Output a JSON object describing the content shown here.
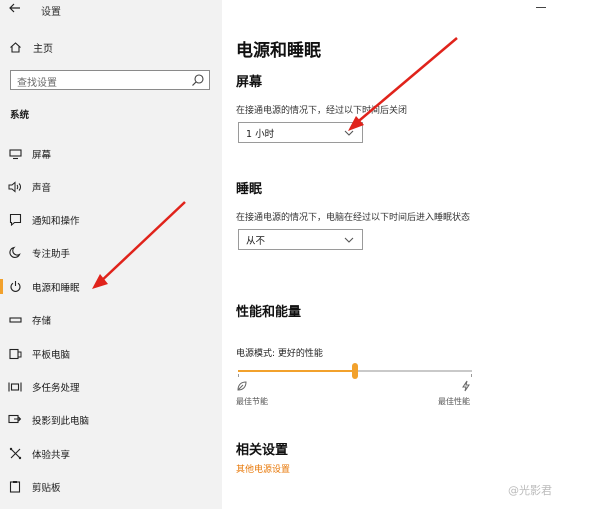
{
  "window": {
    "title": "设置"
  },
  "sidebar": {
    "home_label": "主页",
    "search_placeholder": "查找设置",
    "section_label": "系统",
    "items": [
      {
        "label": "屏幕",
        "icon": "monitor-icon"
      },
      {
        "label": "声音",
        "icon": "speaker-icon"
      },
      {
        "label": "通知和操作",
        "icon": "notification-icon"
      },
      {
        "label": "专注助手",
        "icon": "moon-icon"
      },
      {
        "label": "电源和睡眠",
        "icon": "power-icon",
        "active": true
      },
      {
        "label": "存储",
        "icon": "storage-icon"
      },
      {
        "label": "平板电脑",
        "icon": "tablet-icon"
      },
      {
        "label": "多任务处理",
        "icon": "multitask-icon"
      },
      {
        "label": "投影到此电脑",
        "icon": "project-icon"
      },
      {
        "label": "体验共享",
        "icon": "share-icon"
      },
      {
        "label": "剪贴板",
        "icon": "clipboard-icon"
      }
    ]
  },
  "main": {
    "title": "电源和睡眠",
    "screen": {
      "heading": "屏幕",
      "description": "在接通电源的情况下，经过以下时间后关闭",
      "value": "1 小时"
    },
    "sleep": {
      "heading": "睡眠",
      "description": "在接通电源的情况下，电脑在经过以下时间后进入睡眠状态",
      "value": "从不"
    },
    "performance": {
      "heading": "性能和能量",
      "mode_label": "电源模式: 更好的性能",
      "slider_fraction": 0.5,
      "left_label": "最佳节能",
      "right_label": "最佳性能"
    },
    "related": {
      "heading": "相关设置",
      "link": "其他电源设置"
    }
  },
  "watermark": "@光影君",
  "colors": {
    "accent": "#f2a12c",
    "link": "#e8790a",
    "arrow": "#e0231b",
    "sidebar_bg": "#f2f2f2"
  }
}
